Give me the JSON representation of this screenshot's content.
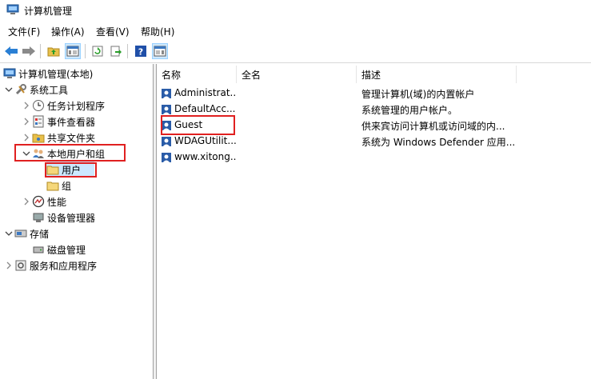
{
  "window": {
    "title": "计算机管理"
  },
  "menu": [
    "文件(F)",
    "操作(A)",
    "查看(V)",
    "帮助(H)"
  ],
  "tree": {
    "root": "计算机管理(本地)",
    "system_tools": "系统工具",
    "task_scheduler": "任务计划程序",
    "event_viewer": "事件查看器",
    "shared_folders": "共享文件夹",
    "local_users_groups": "本地用户和组",
    "users": "用户",
    "groups": "组",
    "performance": "性能",
    "device_manager": "设备管理器",
    "storage": "存储",
    "disk_management": "磁盘管理",
    "services_apps": "服务和应用程序"
  },
  "list": {
    "columns": [
      "名称",
      "全名",
      "描述"
    ],
    "rows": [
      {
        "name": "Administrat...",
        "fullname": "",
        "desc": "管理计算机(域)的内置帐户"
      },
      {
        "name": "DefaultAcc...",
        "fullname": "",
        "desc": "系统管理的用户帐户。"
      },
      {
        "name": "Guest",
        "fullname": "",
        "desc": "供来宾访问计算机或访问域的内..."
      },
      {
        "name": "WDAGUtilit...",
        "fullname": "",
        "desc": "系统为 Windows Defender 应用..."
      },
      {
        "name": "www.xitong...",
        "fullname": "",
        "desc": ""
      }
    ]
  },
  "colors": {
    "highlight": "#e02020",
    "selection": "#cce8ff",
    "accent": "#0063b1"
  }
}
